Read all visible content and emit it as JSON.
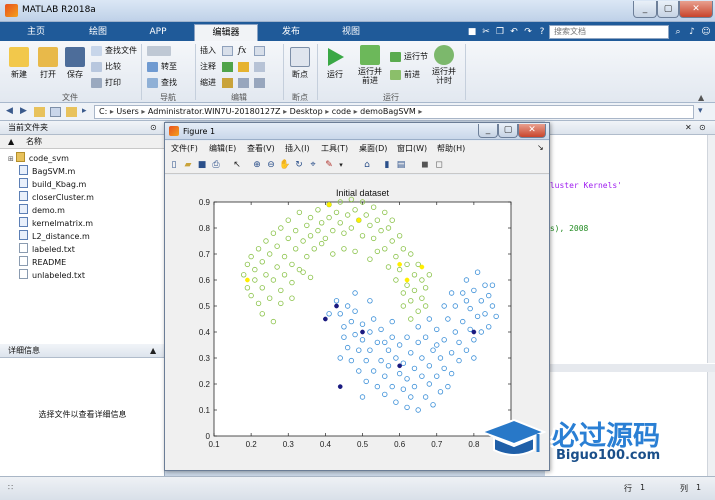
{
  "window": {
    "title": "MATLAB R2018a"
  },
  "tabs": [
    {
      "label": "主页",
      "active": false
    },
    {
      "label": "绘图",
      "active": false
    },
    {
      "label": "APP",
      "active": false
    },
    {
      "label": "编辑器",
      "active": true
    },
    {
      "label": "发布",
      "active": false
    },
    {
      "label": "视图",
      "active": false
    }
  ],
  "search": {
    "placeholder": "搜索文档"
  },
  "ribbon": {
    "file": {
      "label": "文件",
      "new": "新建",
      "open": "打开",
      "save": "保存",
      "find_files": "查找文件",
      "compare": "比较",
      "print": "打印"
    },
    "navigate": {
      "label": "导航",
      "goto": "转至",
      "find": "查找"
    },
    "edit": {
      "label": "编辑",
      "insert": "插入",
      "comment": "注释",
      "indent": "缩进",
      "fx": "fx"
    },
    "breakpoints": {
      "label": "断点",
      "breakpoints": "断点"
    },
    "run": {
      "label": "运行",
      "run": "运行",
      "run_advance": "运行并\n前进",
      "run_section": "运行节",
      "advance": "前进",
      "run_time": "运行并\n计时"
    }
  },
  "path": {
    "segments": [
      "C:",
      "Users",
      "Administrator.WIN7U-20180127Z",
      "Desktop",
      "code",
      "demoBagSVM"
    ]
  },
  "left_panel": {
    "title": "当前文件夹",
    "column": "名称",
    "files": [
      {
        "name": "code_svm",
        "kind": "folder"
      },
      {
        "name": "BagSVM.m",
        "kind": "m"
      },
      {
        "name": "build_Kbag.m",
        "kind": "m"
      },
      {
        "name": "closerCluster.m",
        "kind": "m"
      },
      {
        "name": "demo.m",
        "kind": "m"
      },
      {
        "name": "kernelmatrix.m",
        "kind": "m"
      },
      {
        "name": "L2_distance.m",
        "kind": "m"
      },
      {
        "name": "labeled.txt",
        "kind": "txt"
      },
      {
        "name": "README",
        "kind": "txt"
      },
      {
        "name": "unlabeled.txt",
        "kind": "txt"
      }
    ],
    "details_title": "详细信息",
    "details_text": "选择文件以查看详细信息"
  },
  "editor_snippets": {
    "line1": "Cluster Kernels'",
    "line2": "es), 2008"
  },
  "figure": {
    "title": "Figure 1",
    "menus": [
      "文件(F)",
      "编辑(E)",
      "查看(V)",
      "插入(I)",
      "工具(T)",
      "桌面(D)",
      "窗口(W)",
      "帮助(H)"
    ]
  },
  "status": {
    "row_label": "行",
    "row": "1",
    "col_label": "列",
    "col": "1"
  },
  "watermark": {
    "text": "必过源码",
    "url": "Biguo100.com"
  },
  "colors": {
    "accent": "#1f5a99",
    "green": "#8bc34a",
    "blue": "#3b8fd8",
    "yellow": "#ffee00",
    "navy": "#1a1a80"
  },
  "chart_data": {
    "type": "scatter",
    "title": "Initial dataset",
    "xlim": [
      0.1,
      0.9
    ],
    "ylim": [
      0,
      0.9
    ],
    "xticks": [
      0.1,
      0.2,
      0.3,
      0.4,
      0.5,
      0.6,
      0.7,
      0.8,
      0.9
    ],
    "yticks": [
      0,
      0.1,
      0.2,
      0.3,
      0.4,
      0.5,
      0.6,
      0.7,
      0.8,
      0.9
    ],
    "series": [
      {
        "marker": "circle-open",
        "color": "#8bc34a",
        "points": [
          [
            0.18,
            0.62
          ],
          [
            0.19,
            0.66
          ],
          [
            0.19,
            0.57
          ],
          [
            0.2,
            0.69
          ],
          [
            0.2,
            0.54
          ],
          [
            0.21,
            0.6
          ],
          [
            0.21,
            0.64
          ],
          [
            0.22,
            0.51
          ],
          [
            0.22,
            0.72
          ],
          [
            0.23,
            0.57
          ],
          [
            0.23,
            0.67
          ],
          [
            0.24,
            0.75
          ],
          [
            0.24,
            0.62
          ],
          [
            0.25,
            0.53
          ],
          [
            0.25,
            0.7
          ],
          [
            0.26,
            0.78
          ],
          [
            0.26,
            0.6
          ],
          [
            0.27,
            0.65
          ],
          [
            0.27,
            0.73
          ],
          [
            0.28,
            0.56
          ],
          [
            0.28,
            0.8
          ],
          [
            0.29,
            0.69
          ],
          [
            0.29,
            0.62
          ],
          [
            0.3,
            0.76
          ],
          [
            0.3,
            0.83
          ],
          [
            0.31,
            0.66
          ],
          [
            0.31,
            0.59
          ],
          [
            0.32,
            0.72
          ],
          [
            0.32,
            0.79
          ],
          [
            0.33,
            0.86
          ],
          [
            0.33,
            0.64
          ],
          [
            0.34,
            0.75
          ],
          [
            0.35,
            0.81
          ],
          [
            0.35,
            0.69
          ],
          [
            0.36,
            0.77
          ],
          [
            0.36,
            0.84
          ],
          [
            0.37,
            0.72
          ],
          [
            0.38,
            0.87
          ],
          [
            0.38,
            0.79
          ],
          [
            0.39,
            0.82
          ],
          [
            0.4,
            0.76
          ],
          [
            0.41,
            0.84
          ],
          [
            0.41,
            0.89
          ],
          [
            0.42,
            0.79
          ],
          [
            0.43,
            0.86
          ],
          [
            0.44,
            0.82
          ],
          [
            0.44,
            0.9
          ],
          [
            0.45,
            0.78
          ],
          [
            0.46,
            0.85
          ],
          [
            0.47,
            0.91
          ],
          [
            0.47,
            0.8
          ],
          [
            0.48,
            0.87
          ],
          [
            0.49,
            0.83
          ],
          [
            0.5,
            0.9
          ],
          [
            0.5,
            0.77
          ],
          [
            0.51,
            0.85
          ],
          [
            0.52,
            0.81
          ],
          [
            0.53,
            0.88
          ],
          [
            0.53,
            0.76
          ],
          [
            0.54,
            0.83
          ],
          [
            0.55,
            0.79
          ],
          [
            0.56,
            0.86
          ],
          [
            0.56,
            0.72
          ],
          [
            0.57,
            0.8
          ],
          [
            0.58,
            0.75
          ],
          [
            0.58,
            0.83
          ],
          [
            0.59,
            0.69
          ],
          [
            0.6,
            0.77
          ],
          [
            0.6,
            0.64
          ],
          [
            0.61,
            0.72
          ],
          [
            0.62,
            0.66
          ],
          [
            0.62,
            0.58
          ],
          [
            0.63,
            0.7
          ],
          [
            0.63,
            0.52
          ],
          [
            0.64,
            0.62
          ],
          [
            0.64,
            0.56
          ],
          [
            0.65,
            0.66
          ],
          [
            0.65,
            0.48
          ],
          [
            0.66,
            0.6
          ],
          [
            0.66,
            0.53
          ],
          [
            0.67,
            0.57
          ],
          [
            0.67,
            0.5
          ],
          [
            0.68,
            0.62
          ],
          [
            0.61,
            0.55
          ],
          [
            0.59,
            0.6
          ],
          [
            0.63,
            0.45
          ],
          [
            0.54,
            0.71
          ],
          [
            0.45,
            0.72
          ],
          [
            0.39,
            0.74
          ],
          [
            0.34,
            0.63
          ],
          [
            0.28,
            0.51
          ],
          [
            0.23,
            0.47
          ],
          [
            0.26,
            0.44
          ],
          [
            0.31,
            0.53
          ],
          [
            0.36,
            0.61
          ],
          [
            0.42,
            0.7
          ],
          [
            0.48,
            0.71
          ],
          [
            0.52,
            0.68
          ],
          [
            0.57,
            0.65
          ],
          [
            0.61,
            0.5
          ]
        ]
      },
      {
        "marker": "circle-open",
        "color": "#3b8fd8",
        "points": [
          [
            0.43,
            0.52
          ],
          [
            0.44,
            0.47
          ],
          [
            0.45,
            0.42
          ],
          [
            0.45,
            0.38
          ],
          [
            0.46,
            0.5
          ],
          [
            0.46,
            0.34
          ],
          [
            0.47,
            0.44
          ],
          [
            0.47,
            0.29
          ],
          [
            0.48,
            0.39
          ],
          [
            0.48,
            0.48
          ],
          [
            0.49,
            0.33
          ],
          [
            0.49,
            0.25
          ],
          [
            0.5,
            0.43
          ],
          [
            0.5,
            0.37
          ],
          [
            0.51,
            0.29
          ],
          [
            0.51,
            0.21
          ],
          [
            0.52,
            0.4
          ],
          [
            0.52,
            0.33
          ],
          [
            0.53,
            0.25
          ],
          [
            0.53,
            0.45
          ],
          [
            0.54,
            0.19
          ],
          [
            0.54,
            0.36
          ],
          [
            0.55,
            0.29
          ],
          [
            0.55,
            0.41
          ],
          [
            0.56,
            0.23
          ],
          [
            0.56,
            0.16
          ],
          [
            0.57,
            0.33
          ],
          [
            0.57,
            0.27
          ],
          [
            0.58,
            0.38
          ],
          [
            0.58,
            0.19
          ],
          [
            0.59,
            0.3
          ],
          [
            0.59,
            0.13
          ],
          [
            0.6,
            0.24
          ],
          [
            0.6,
            0.35
          ],
          [
            0.61,
            0.18
          ],
          [
            0.61,
            0.28
          ],
          [
            0.62,
            0.11
          ],
          [
            0.62,
            0.22
          ],
          [
            0.63,
            0.32
          ],
          [
            0.63,
            0.15
          ],
          [
            0.64,
            0.26
          ],
          [
            0.64,
            0.19
          ],
          [
            0.65,
            0.36
          ],
          [
            0.65,
            0.1
          ],
          [
            0.66,
            0.23
          ],
          [
            0.66,
            0.3
          ],
          [
            0.67,
            0.15
          ],
          [
            0.67,
            0.38
          ],
          [
            0.68,
            0.2
          ],
          [
            0.68,
            0.27
          ],
          [
            0.69,
            0.12
          ],
          [
            0.69,
            0.33
          ],
          [
            0.7,
            0.23
          ],
          [
            0.7,
            0.41
          ],
          [
            0.71,
            0.17
          ],
          [
            0.71,
            0.3
          ],
          [
            0.72,
            0.26
          ],
          [
            0.72,
            0.37
          ],
          [
            0.73,
            0.19
          ],
          [
            0.73,
            0.45
          ],
          [
            0.74,
            0.32
          ],
          [
            0.74,
            0.24
          ],
          [
            0.75,
            0.4
          ],
          [
            0.75,
            0.5
          ],
          [
            0.76,
            0.29
          ],
          [
            0.76,
            0.36
          ],
          [
            0.77,
            0.44
          ],
          [
            0.77,
            0.55
          ],
          [
            0.78,
            0.33
          ],
          [
            0.78,
            0.6
          ],
          [
            0.79,
            0.41
          ],
          [
            0.79,
            0.49
          ],
          [
            0.8,
            0.37
          ],
          [
            0.8,
            0.56
          ],
          [
            0.81,
            0.46
          ],
          [
            0.81,
            0.63
          ],
          [
            0.82,
            0.52
          ],
          [
            0.82,
            0.4
          ],
          [
            0.83,
            0.58
          ],
          [
            0.83,
            0.47
          ],
          [
            0.84,
            0.54
          ],
          [
            0.84,
            0.42
          ],
          [
            0.85,
            0.5
          ],
          [
            0.85,
            0.58
          ],
          [
            0.86,
            0.46
          ],
          [
            0.72,
            0.5
          ],
          [
            0.78,
            0.52
          ],
          [
            0.7,
            0.35
          ],
          [
            0.65,
            0.42
          ],
          [
            0.58,
            0.44
          ],
          [
            0.52,
            0.52
          ],
          [
            0.48,
            0.55
          ],
          [
            0.41,
            0.47
          ],
          [
            0.44,
            0.3
          ],
          [
            0.5,
            0.15
          ],
          [
            0.56,
            0.36
          ],
          [
            0.62,
            0.38
          ],
          [
            0.68,
            0.45
          ],
          [
            0.74,
            0.55
          ],
          [
            0.8,
            0.3
          ]
        ]
      },
      {
        "marker": "dot",
        "color": "#ffee00",
        "points": [
          [
            0.41,
            0.89
          ],
          [
            0.49,
            0.83
          ],
          [
            0.6,
            0.66
          ],
          [
            0.62,
            0.6
          ],
          [
            0.66,
            0.65
          ],
          [
            0.19,
            0.6
          ]
        ]
      },
      {
        "marker": "dot",
        "color": "#1a1a80",
        "points": [
          [
            0.4,
            0.45
          ],
          [
            0.43,
            0.5
          ],
          [
            0.5,
            0.4
          ],
          [
            0.6,
            0.27
          ],
          [
            0.8,
            0.4
          ],
          [
            0.44,
            0.19
          ]
        ]
      }
    ]
  }
}
